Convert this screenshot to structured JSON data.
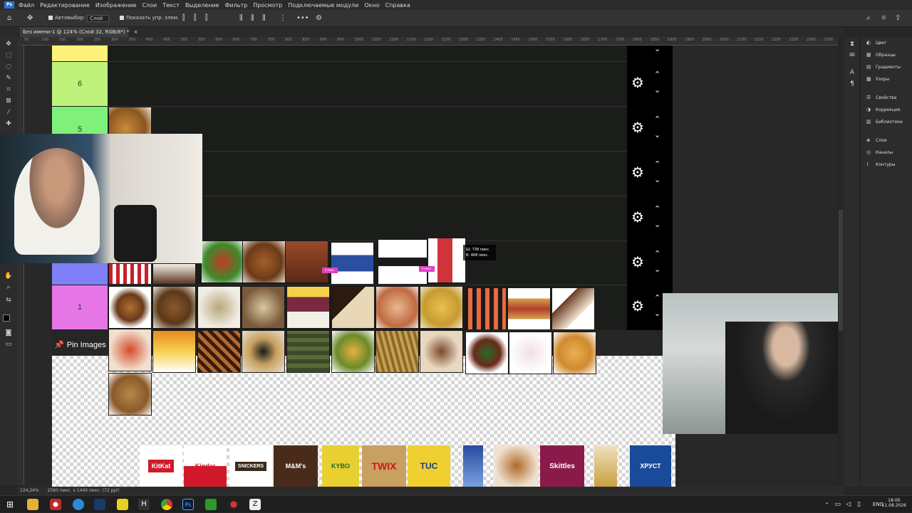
{
  "menu": {
    "items": [
      "Файл",
      "Редактирование",
      "Изображение",
      "Слои",
      "Текст",
      "Выделение",
      "Фильтр",
      "Просмотр",
      "Подключаемые модули",
      "Окно",
      "Справка"
    ]
  },
  "options": {
    "autoselect_label": "Автовыбор:",
    "autoselect_value": "Слой",
    "show_controls_label": "Показать упр. элем."
  },
  "document": {
    "tab_title": "Без имени-1 @ 124% (Слой 32, RGB/8*) *",
    "close": "×"
  },
  "ruler": {
    "ticks": [
      "50",
      "100",
      "150",
      "200",
      "250",
      "300",
      "350",
      "400",
      "450",
      "500",
      "550",
      "600",
      "650",
      "700",
      "750",
      "800",
      "850",
      "900",
      "950",
      "1000",
      "1050",
      "1100",
      "1150",
      "1200",
      "1250",
      "1300",
      "1350",
      "1400",
      "1450",
      "1500",
      "1550",
      "1600",
      "1650",
      "1700",
      "1750",
      "1800",
      "1850",
      "1900",
      "1950",
      "2000",
      "2050",
      "2100",
      "2150",
      "2200",
      "2250",
      "2300",
      "2350"
    ]
  },
  "tiers": [
    {
      "label": "6",
      "color": "#bff27a"
    },
    {
      "label": "5",
      "color": "#7ff07a"
    },
    {
      "label": "1",
      "color": "#e676e6"
    }
  ],
  "tier_colors": {
    "top_stub": "#fff27a",
    "tier2_stub": "#7f7ff7"
  },
  "pin_images": {
    "label": "Pin Images"
  },
  "hud": {
    "w": "Ш: 738 пикс.",
    "h": "В: 468 пикс."
  },
  "tags": [
    "3 пикс.",
    "3 пикс."
  ],
  "brands": [
    "KitKat",
    "Kinder",
    "SNICKERS",
    "M&M's",
    "KYBO",
    "TWIX",
    "TUC",
    "",
    "",
    "Skittles",
    "",
    "ХРУСТ"
  ],
  "right_panel": {
    "items": [
      "Цвет",
      "Образцы",
      "Градиенты",
      "Узоры",
      "Свойства",
      "Коррекция",
      "Библиотеки",
      "Слои",
      "Каналы",
      "Контуры"
    ]
  },
  "status": {
    "zoom": "124,24%",
    "size": "2560 пикс. x 1440 пикс. (72 ppi)"
  },
  "taskbar": {
    "lang": "ENG",
    "time": "18:00",
    "date": "11.08.2026"
  },
  "colors": {
    "accent": "#2f6fd1",
    "pin_red": "#dd3333",
    "tag_pink": "#e040c0"
  }
}
